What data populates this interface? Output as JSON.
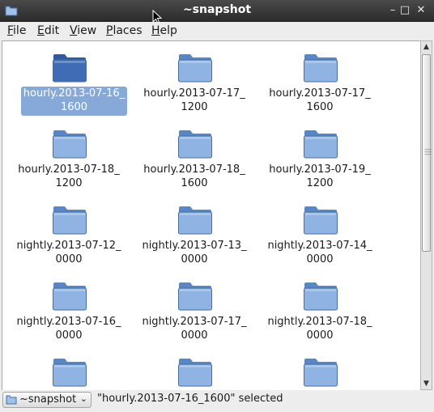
{
  "window": {
    "title": "~snapshot",
    "controls": {
      "minimize": "–",
      "maximize": "□",
      "close": "✕"
    }
  },
  "menu": [
    {
      "label": "File",
      "mnemonic": "F",
      "rest": "ile"
    },
    {
      "label": "Edit",
      "mnemonic": "E",
      "rest": "dit"
    },
    {
      "label": "View",
      "mnemonic": "V",
      "rest": "iew"
    },
    {
      "label": "Places",
      "mnemonic": "P",
      "rest": "laces"
    },
    {
      "label": "Help",
      "mnemonic": "H",
      "rest": "elp"
    }
  ],
  "items": [
    {
      "line1": "hourly.2013-07-16_",
      "line2": "1600",
      "selected": true
    },
    {
      "line1": "hourly.2013-07-17_",
      "line2": "1200",
      "selected": false
    },
    {
      "line1": "hourly.2013-07-17_",
      "line2": "1600",
      "selected": false
    },
    {
      "line1": "hourly.2013-07-18_",
      "line2": "1200",
      "selected": false
    },
    {
      "line1": "hourly.2013-07-18_",
      "line2": "1600",
      "selected": false
    },
    {
      "line1": "hourly.2013-07-19_",
      "line2": "1200",
      "selected": false
    },
    {
      "line1": "nightly.2013-07-12_",
      "line2": "0000",
      "selected": false
    },
    {
      "line1": "nightly.2013-07-13_",
      "line2": "0000",
      "selected": false
    },
    {
      "line1": "nightly.2013-07-14_",
      "line2": "0000",
      "selected": false
    },
    {
      "line1": "nightly.2013-07-16_",
      "line2": "0000",
      "selected": false
    },
    {
      "line1": "nightly.2013-07-17_",
      "line2": "0000",
      "selected": false
    },
    {
      "line1": "nightly.2013-07-18_",
      "line2": "0000",
      "selected": false
    },
    {
      "line1": "",
      "line2": "",
      "selected": false
    },
    {
      "line1": "",
      "line2": "",
      "selected": false
    },
    {
      "line1": "",
      "line2": "",
      "selected": false
    }
  ],
  "statusbar": {
    "location": "~snapshot",
    "status": "\"hourly.2013-07-16_1600\" selected"
  },
  "colors": {
    "folder_light": "#8fb4e3",
    "folder_dark": "#5b86c4",
    "folder_selected": "#3e6db5",
    "selection": "#86a9d8"
  },
  "icons": {
    "app": "folder-icon",
    "folder": "folder-icon",
    "location": "folder-icon",
    "cursor": "mouse-pointer-icon"
  }
}
